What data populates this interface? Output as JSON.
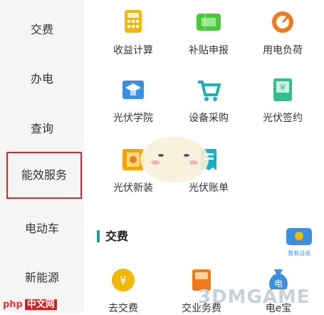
{
  "sidebar": {
    "items": [
      {
        "label": "交费"
      },
      {
        "label": "办电"
      },
      {
        "label": "查询"
      },
      {
        "label": "能效服务",
        "active": true
      },
      {
        "label": "电动车"
      },
      {
        "label": "新能源"
      }
    ],
    "active_border_color": "#d8282f"
  },
  "grid": [
    {
      "label": "收益计算",
      "icon": "calculator-icon",
      "color": "#f5b800"
    },
    {
      "label": "补贴申报",
      "icon": "ticket-icon",
      "color": "#4cc93a"
    },
    {
      "label": "用电负荷",
      "icon": "gauge-icon",
      "color": "#f07a1a"
    },
    {
      "label": "光伏学院",
      "icon": "graduation-cap-icon",
      "color": "#3a8fe0"
    },
    {
      "label": "设备采购",
      "icon": "shopping-cart-icon",
      "color": "#19b3b8"
    },
    {
      "label": "光伏签约",
      "icon": "contract-icon",
      "color": "#2fbf8f"
    },
    {
      "label": "光伏新装",
      "icon": "installation-icon",
      "color": "#f0a500"
    },
    {
      "label": "光伏账单",
      "icon": "bill-icon",
      "color": "#16b0c4"
    }
  ],
  "section": {
    "title": "交费",
    "accent": "#1aa39a"
  },
  "payment": [
    {
      "label": "去交费",
      "icon": "yuan-coin-icon",
      "color": "#f5b800"
    },
    {
      "label": "交业务费",
      "icon": "fee-icon",
      "color": "#f07a1a"
    },
    {
      "label": "电e宝",
      "icon": "money-bag-icon",
      "color": "#3a8fe0"
    }
  ],
  "badge": {
    "label": "我有话说"
  },
  "watermarks": {
    "left_prefix": "php",
    "left_label": "中文网",
    "right": "3DMGAME"
  }
}
